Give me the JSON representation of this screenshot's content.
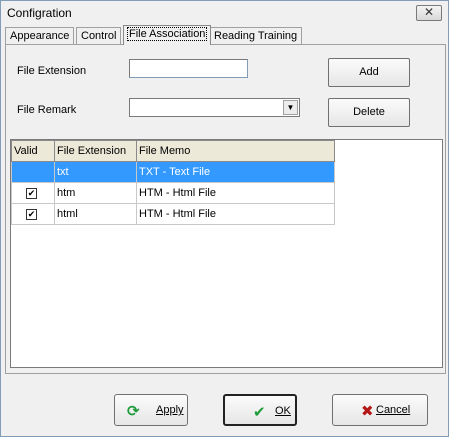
{
  "window": {
    "title": "Configration",
    "close_glyph": "✕"
  },
  "tabs": [
    {
      "label": "Appearance"
    },
    {
      "label": "Control"
    },
    {
      "label": "File Association"
    },
    {
      "label": "Reading Training"
    }
  ],
  "form": {
    "ext_label": "File Extension",
    "ext_value": "",
    "remark_label": "File Remark",
    "remark_value": "",
    "add_label": "Add",
    "delete_label": "Delete"
  },
  "table": {
    "headers": [
      "Valid",
      "File Extension",
      "File Memo"
    ],
    "rows": [
      {
        "valid": false,
        "check": "",
        "ext": "txt",
        "memo": "TXT - Text File"
      },
      {
        "valid": true,
        "check": "✔",
        "ext": "htm",
        "memo": "HTM - Html File"
      },
      {
        "valid": true,
        "check": "✔",
        "ext": "html",
        "memo": "HTM - Html File"
      }
    ]
  },
  "buttons": {
    "apply": "Apply",
    "ok": "OK",
    "cancel": "Cancel"
  },
  "colors": {
    "selection": "#3399ff",
    "apply_icon": "#1e9b3a",
    "ok_icon": "#1e9b3a",
    "cancel_icon": "#b51818"
  }
}
